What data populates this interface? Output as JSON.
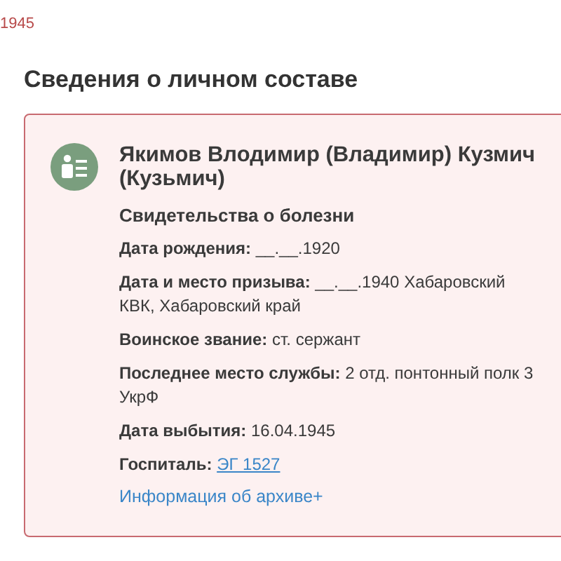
{
  "top_fragment": "1945",
  "heading": "Сведения о личном составе",
  "record": {
    "name": "Якимов Влодимир (Владимир) Кузмич (Кузьмич)",
    "document": "Свидетельства о болезни",
    "fields": [
      {
        "kind": "text",
        "label": "Дата рождения:",
        "value": "__.__.1920"
      },
      {
        "kind": "text",
        "label": "Дата и место призыва:",
        "value": "__.__.1940 Хабаровский КВК, Хабаровский край"
      },
      {
        "kind": "text",
        "label": "Воинское звание:",
        "value": "ст. сержант"
      },
      {
        "kind": "text",
        "label": "Последнее место службы:",
        "value": "2 отд. понтонный полк 3 УкрФ"
      },
      {
        "kind": "text",
        "label": "Дата выбытия:",
        "value": "16.04.1945"
      },
      {
        "kind": "link",
        "label": "Госпиталь:",
        "value": "ЭГ 1527"
      }
    ],
    "archive_link": "Информация об архиве+"
  }
}
